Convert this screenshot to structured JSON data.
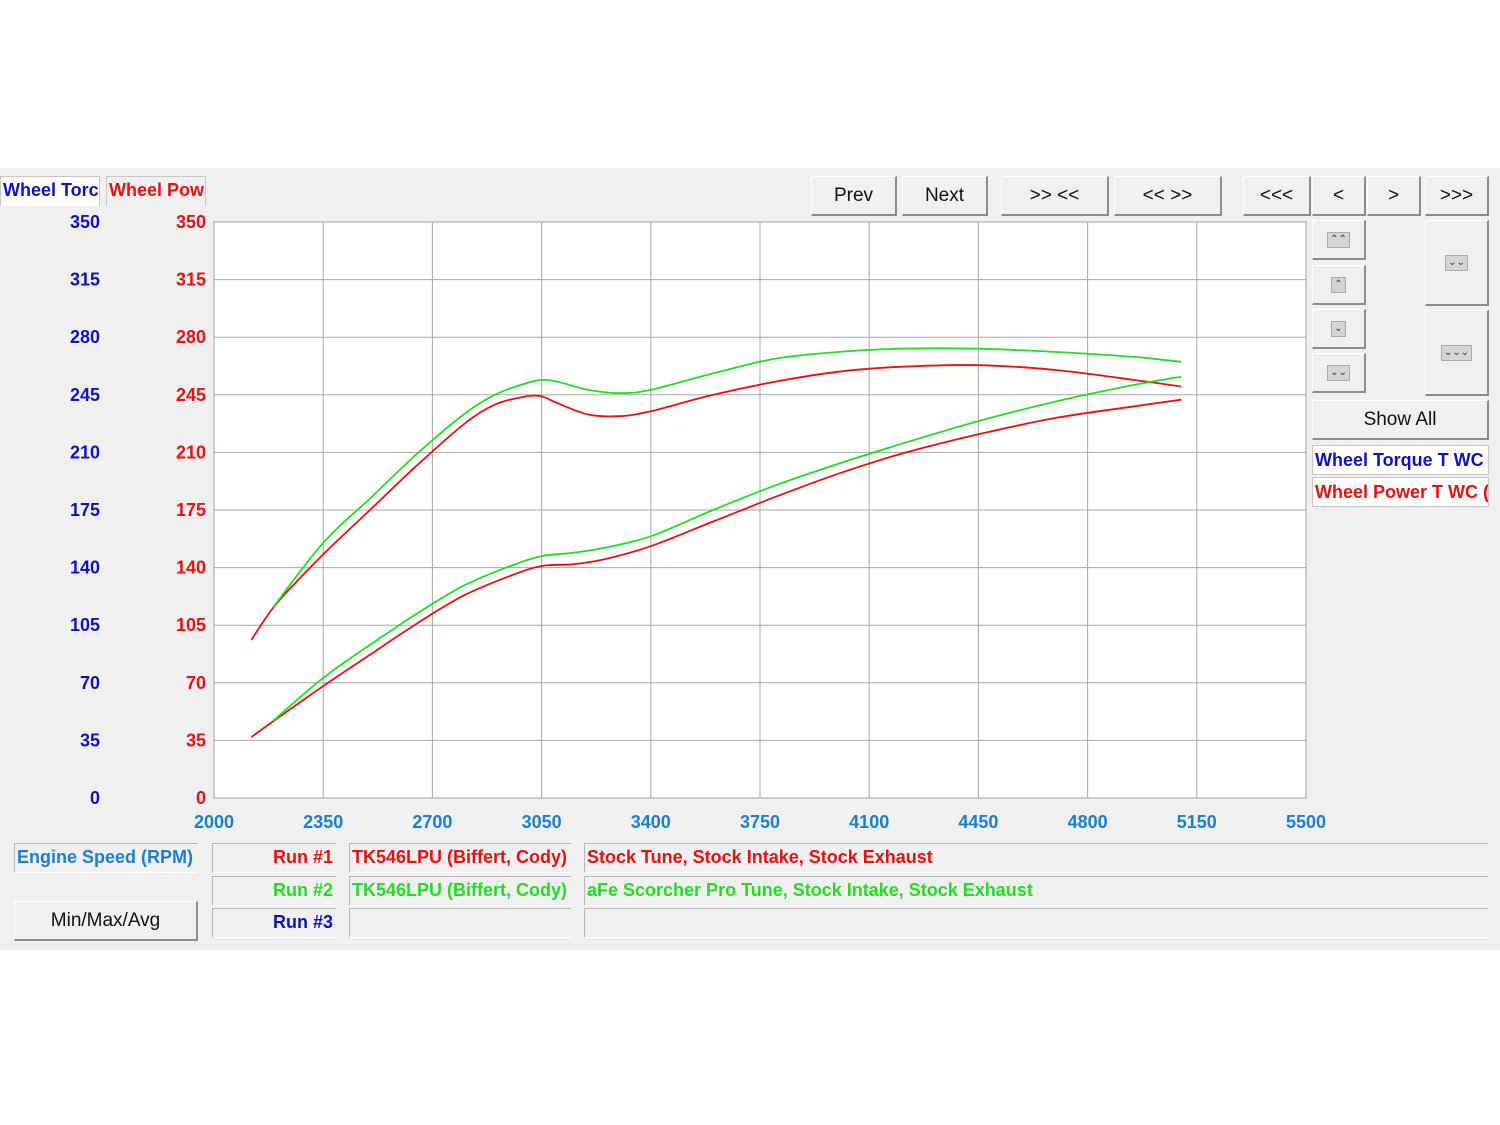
{
  "tabs": [
    {
      "label": "Wheel Torc",
      "color": "#1010c8"
    },
    {
      "label": "Wheel Pow",
      "color": "#e81010"
    }
  ],
  "nav_buttons": {
    "prev": "Prev",
    "next": "Next",
    "zoom_in": ">> <<",
    "zoom_out": "<< >>",
    "first": "<<<",
    "left": "<",
    "right": ">",
    "last": ">>>"
  },
  "scroll_buttons": {
    "page_up": "⌃⌃",
    "up": "⌃",
    "down": "⌄",
    "page_down": "⌄⌄",
    "expand": "⌄⌄",
    "collapse": "⌄⌄⌄"
  },
  "show_all": "Show All",
  "legend": [
    {
      "label": "Wheel Torque T WC",
      "color": "#1010c8"
    },
    {
      "label": "Wheel Power T WC (",
      "color": "#e81010"
    }
  ],
  "xaxis_label": "Engine Speed (RPM)",
  "minmax_button": "Min/Max/Avg",
  "runs": [
    {
      "label": "Run #1",
      "vehicle": "TK546LPU (Biffert, Cody)",
      "description": "Stock Tune, Stock Intake, Stock Exhaust",
      "color": "#e81010"
    },
    {
      "label": "Run #2",
      "vehicle": "TK546LPU (Biffert, Cody)",
      "description": "aFe Scorcher Pro Tune, Stock Intake, Stock Exhaust",
      "color": "#22dd22"
    },
    {
      "label": "Run #3",
      "vehicle": "",
      "description": "",
      "color": "#1010c8"
    }
  ],
  "chart_data": {
    "type": "line",
    "x_ticks": [
      2000,
      2350,
      2700,
      3050,
      3400,
      3750,
      4100,
      4450,
      4800,
      5150,
      5500
    ],
    "y_ticks": [
      0,
      35,
      70,
      105,
      140,
      175,
      210,
      245,
      280,
      315,
      350
    ],
    "xlim": [
      2000,
      5500
    ],
    "ylim": [
      0,
      350
    ],
    "grid": true,
    "left_axis_color": "#1010c8",
    "right_axis_color": "#e81010",
    "x_tick_color": "#1a7fd4",
    "series": [
      {
        "name": "Run #1 Torque",
        "color": "#e81010",
        "x": [
          2120,
          2200,
          2350,
          2500,
          2650,
          2800,
          2900,
          3000,
          3050,
          3100,
          3200,
          3300,
          3400,
          3600,
          3800,
          4000,
          4200,
          4450,
          4700,
          4950,
          5100
        ],
        "y": [
          96,
          118,
          148,
          175,
          202,
          227,
          239,
          244,
          244,
          240,
          233,
          232,
          235,
          245,
          253,
          259,
          262,
          263,
          260,
          254,
          250
        ]
      },
      {
        "name": "Run #2 Torque",
        "color": "#22dd22",
        "x": [
          2190,
          2350,
          2500,
          2650,
          2800,
          2900,
          3000,
          3050,
          3100,
          3200,
          3300,
          3400,
          3600,
          3800,
          4000,
          4200,
          4450,
          4700,
          4950,
          5100
        ],
        "y": [
          116,
          155,
          182,
          209,
          233,
          245,
          252,
          254,
          253,
          248,
          246,
          248,
          258,
          267,
          271,
          273,
          273,
          271,
          268,
          265
        ]
      },
      {
        "name": "Run #1 Power",
        "color": "#e81010",
        "x": [
          2120,
          2200,
          2350,
          2500,
          2650,
          2800,
          2950,
          3050,
          3150,
          3250,
          3400,
          3600,
          3800,
          4000,
          4200,
          4450,
          4700,
          4950,
          5100
        ],
        "y": [
          37,
          48,
          68,
          87,
          106,
          123,
          135,
          141,
          142,
          145,
          153,
          168,
          183,
          197,
          209,
          221,
          231,
          238,
          242
        ]
      },
      {
        "name": "Run #2 Power",
        "color": "#22dd22",
        "x": [
          2190,
          2350,
          2500,
          2650,
          2800,
          2950,
          3050,
          3150,
          3250,
          3400,
          3600,
          3800,
          4000,
          4200,
          4450,
          4700,
          4950,
          5100
        ],
        "y": [
          47,
          73,
          93,
          112,
          129,
          141,
          147,
          149,
          152,
          159,
          175,
          190,
          203,
          215,
          229,
          241,
          251,
          256
        ]
      }
    ]
  }
}
